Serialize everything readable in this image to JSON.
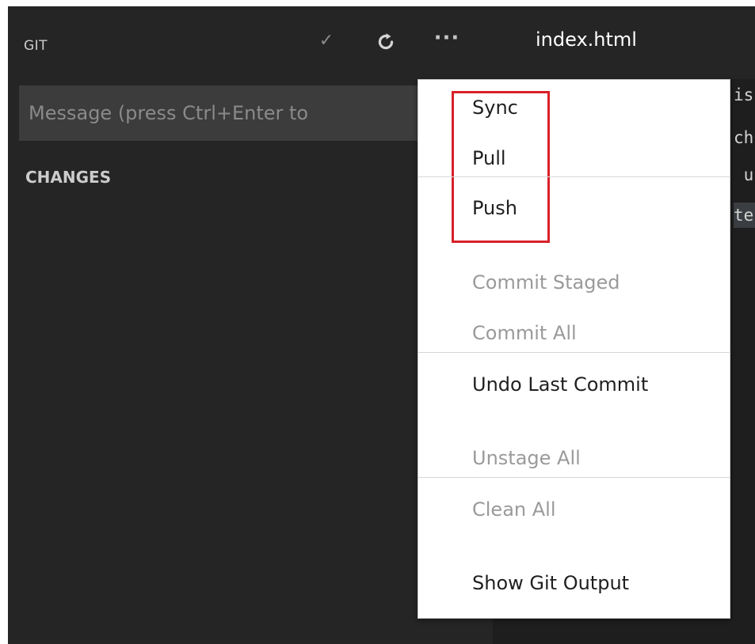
{
  "git_panel": {
    "title": "GIT",
    "toolbar": {
      "commit_icon": "check-icon",
      "refresh_icon": "refresh-icon",
      "more_icon": "ellipsis-icon"
    },
    "message_placeholder": "Message (press Ctrl+Enter to",
    "changes_header": "CHANGES"
  },
  "editor": {
    "tab_title": "index.html",
    "code_fragments": [
      "is",
      "ch",
      " u",
      "te"
    ]
  },
  "menu": {
    "group1": [
      "Sync",
      "Pull",
      "Push"
    ],
    "group2": [
      "Commit Staged",
      "Commit All",
      "Undo Last Commit"
    ],
    "group3": [
      "Unstage All",
      "Clean All"
    ],
    "group4": [
      "Show Git Output"
    ],
    "highlight_color": "#d9202a"
  }
}
